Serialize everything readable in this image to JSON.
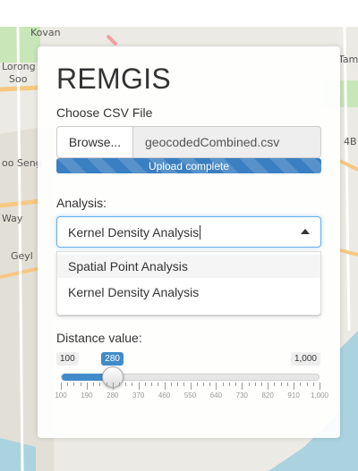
{
  "map": {
    "labels": [
      "Kovan",
      "Lorong",
      "Soo",
      "oo Seng",
      "Way",
      "Geyl",
      "Tampine",
      "4B"
    ],
    "colors": {
      "land": "#eceae4",
      "sea": "#aad3df",
      "major_road": "#f7c882",
      "park": "#c8e6b8"
    }
  },
  "panel": {
    "title": "REMGIS",
    "file": {
      "label": "Choose CSV File",
      "browse_label": "Browse...",
      "file_name": "geocodedCombined.csv",
      "progress_text": "Upload complete",
      "progress_fraction": 1.0,
      "progress_color": "#3a7fc1"
    },
    "analysis": {
      "label": "Analysis:",
      "value": "Kernel Density Analysis",
      "options": [
        "Spatial Point Analysis",
        "Kernel Density Analysis"
      ]
    },
    "distance": {
      "label": "Distance value:",
      "min": 100,
      "max": 1000,
      "value": 280,
      "min_label": "100",
      "max_label": "1,000",
      "value_label": "280",
      "tick_labels": [
        "100",
        "190",
        "280",
        "370",
        "460",
        "550",
        "640",
        "730",
        "820",
        "910",
        "1,000"
      ],
      "accent": "#428bca"
    }
  }
}
